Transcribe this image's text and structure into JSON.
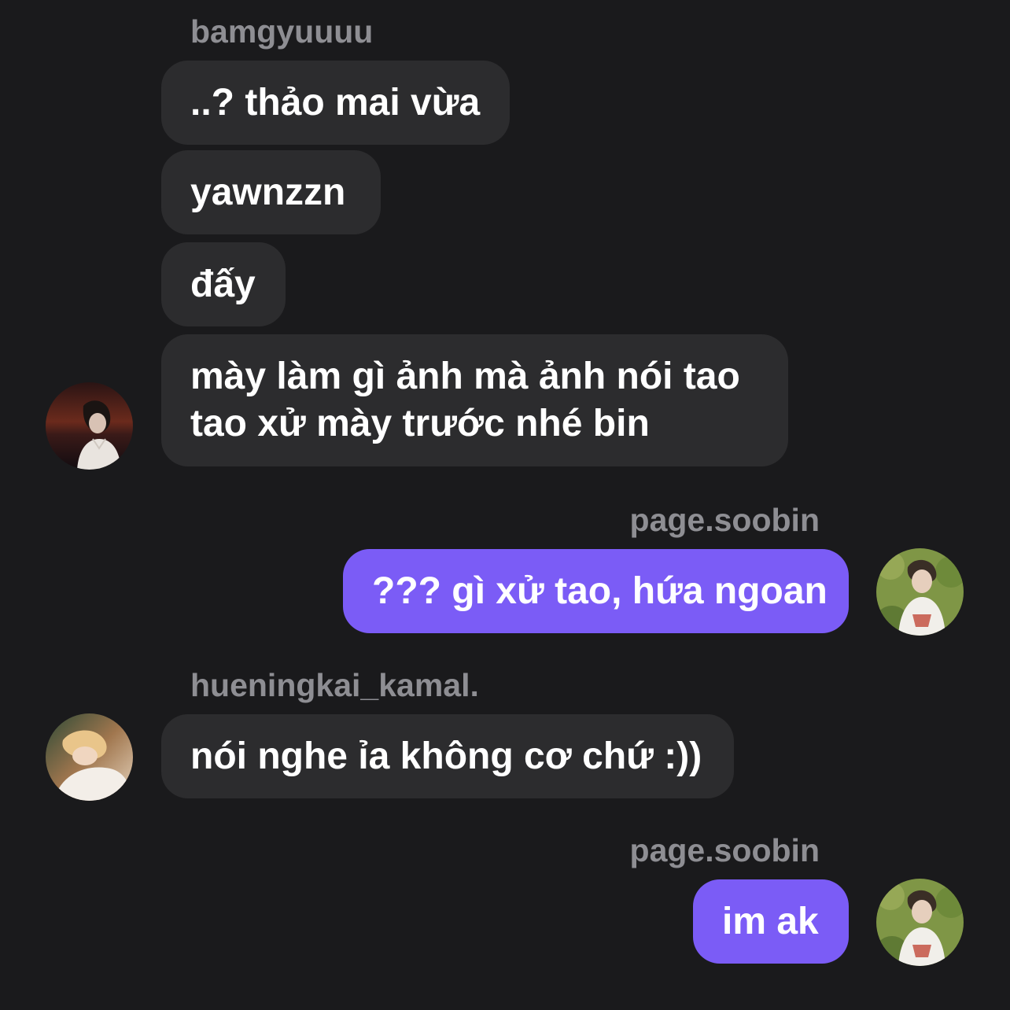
{
  "colors": {
    "background": "#1a1a1c",
    "incoming_bubble": "#2c2c2e",
    "outgoing_bubble": "#7b5cf6",
    "sender_name": "#8e8e93",
    "text": "#ffffff"
  },
  "group1": {
    "sender": "bamgyuuuu",
    "avatar_icon": "user-avatar-icon",
    "messages": [
      {
        "text": "..? thảo mai vừa"
      },
      {
        "text": "yawnzzn"
      },
      {
        "text": "đấy"
      },
      {
        "lines": [
          "mày làm gì ảnh mà ảnh nói tao",
          "tao xử mày trước nhé bin"
        ]
      }
    ]
  },
  "group2": {
    "sender": "page.soobin",
    "avatar_icon": "user-avatar-icon",
    "messages": [
      {
        "text": "??? gì xử tao, hứa ngoan"
      }
    ]
  },
  "group3": {
    "sender": "hueningkai_kamal.",
    "avatar_icon": "user-avatar-icon",
    "messages": [
      {
        "text": "nói nghe ỉa không cơ chứ :))"
      }
    ]
  },
  "group4": {
    "sender": "page.soobin",
    "avatar_icon": "user-avatar-icon",
    "messages": [
      {
        "text": "im ak"
      }
    ]
  }
}
